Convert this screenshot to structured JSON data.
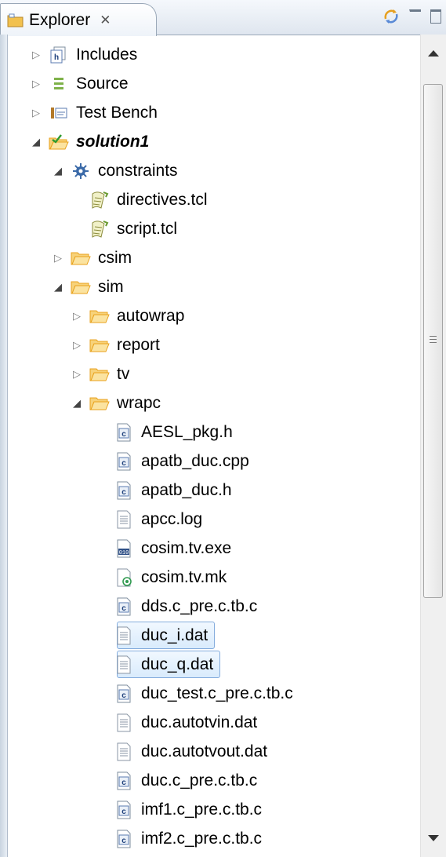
{
  "tab": {
    "title": "Explorer",
    "close_glyph": "✕"
  },
  "icons": {
    "folder": "folder-icon",
    "c_file": "c-file-icon",
    "text_file": "text-file-icon",
    "tcl": "tcl-script-icon",
    "exe": "binary-file-icon",
    "mk": "makefile-icon"
  },
  "colors": {
    "folder": "#e8a21c",
    "selection": "#d9ebfc",
    "selection_border": "#84acdd"
  },
  "tree": [
    {
      "label": "Includes",
      "icon": "includes",
      "twisty": "closed",
      "level": 2
    },
    {
      "label": "Source",
      "icon": "source",
      "twisty": "closed",
      "level": 2
    },
    {
      "label": "Test Bench",
      "icon": "testbench",
      "twisty": "closed",
      "level": 2
    },
    {
      "label": "solution1",
      "icon": "solution",
      "twisty": "open",
      "level": 2,
      "bold": true
    },
    {
      "label": "constraints",
      "icon": "gear",
      "twisty": "open",
      "level": 3
    },
    {
      "label": "directives.tcl",
      "icon": "tcl",
      "twisty": "none",
      "level": 4
    },
    {
      "label": "script.tcl",
      "icon": "tcl",
      "twisty": "none",
      "level": 4
    },
    {
      "label": "csim",
      "icon": "folder",
      "twisty": "closed",
      "level": 3
    },
    {
      "label": "sim",
      "icon": "folder",
      "twisty": "open",
      "level": 3
    },
    {
      "label": "autowrap",
      "icon": "folder",
      "twisty": "closed",
      "level": 4
    },
    {
      "label": "report",
      "icon": "folder",
      "twisty": "closed",
      "level": 4
    },
    {
      "label": "tv",
      "icon": "folder",
      "twisty": "closed",
      "level": 4
    },
    {
      "label": "wrapc",
      "icon": "folder",
      "twisty": "open",
      "level": 4
    },
    {
      "label": "AESL_pkg.h",
      "icon": "c",
      "twisty": "none",
      "level": 5
    },
    {
      "label": "apatb_duc.cpp",
      "icon": "c",
      "twisty": "none",
      "level": 5
    },
    {
      "label": "apatb_duc.h",
      "icon": "c",
      "twisty": "none",
      "level": 5
    },
    {
      "label": "apcc.log",
      "icon": "text",
      "twisty": "none",
      "level": 5
    },
    {
      "label": "cosim.tv.exe",
      "icon": "exe",
      "twisty": "none",
      "level": 5
    },
    {
      "label": "cosim.tv.mk",
      "icon": "mk",
      "twisty": "none",
      "level": 5
    },
    {
      "label": "dds.c_pre.c.tb.c",
      "icon": "c",
      "twisty": "none",
      "level": 5
    },
    {
      "label": "duc_i.dat",
      "icon": "text",
      "twisty": "none",
      "level": 5,
      "selected": true
    },
    {
      "label": "duc_q.dat",
      "icon": "text",
      "twisty": "none",
      "level": 5,
      "selected": true
    },
    {
      "label": "duc_test.c_pre.c.tb.c",
      "icon": "c",
      "twisty": "none",
      "level": 5
    },
    {
      "label": "duc.autotvin.dat",
      "icon": "text",
      "twisty": "none",
      "level": 5
    },
    {
      "label": "duc.autotvout.dat",
      "icon": "text",
      "twisty": "none",
      "level": 5
    },
    {
      "label": "duc.c_pre.c.tb.c",
      "icon": "c",
      "twisty": "none",
      "level": 5
    },
    {
      "label": "imf1.c_pre.c.tb.c",
      "icon": "c",
      "twisty": "none",
      "level": 5
    },
    {
      "label": "imf2.c_pre.c.tb.c",
      "icon": "c",
      "twisty": "none",
      "level": 5
    }
  ]
}
